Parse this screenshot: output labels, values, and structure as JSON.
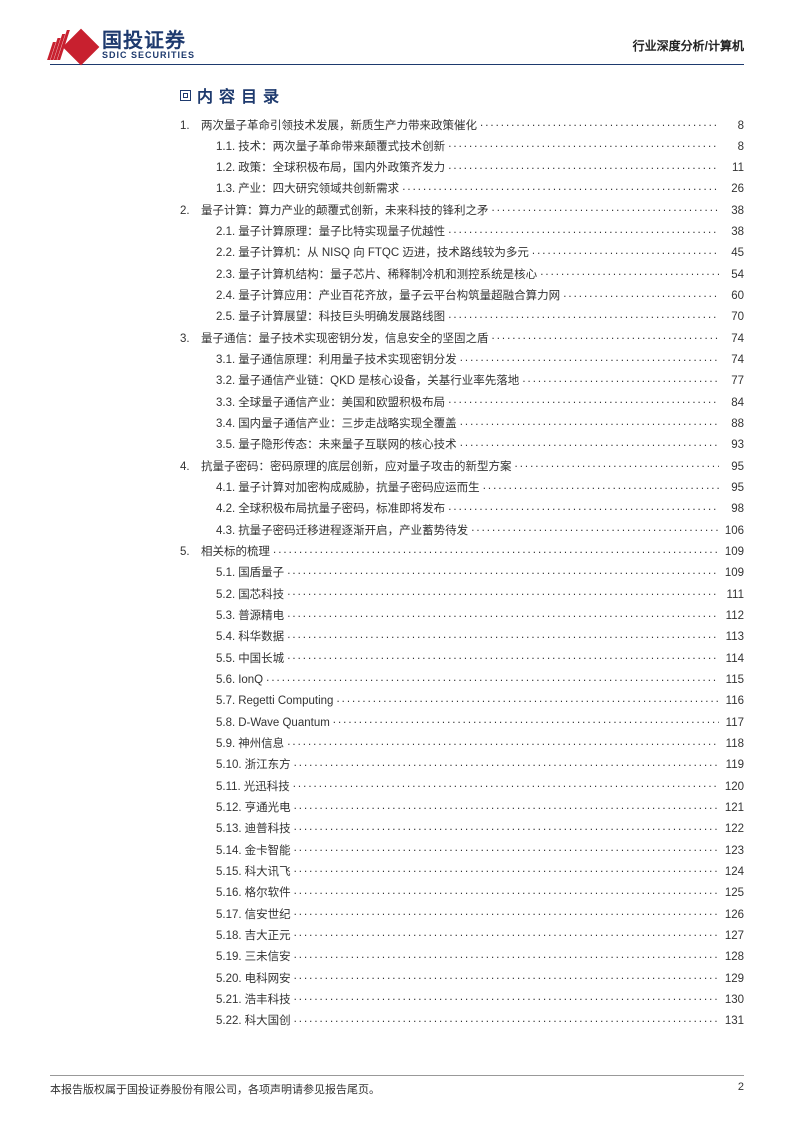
{
  "header": {
    "logo_cn": "国投证券",
    "logo_en": "SDIC SECURITIES",
    "doc_tag": "行业深度分析/计算机"
  },
  "toc_title": "内容目录",
  "toc": [
    {
      "level": 1,
      "num": "1.",
      "text": "两次量子革命引领技术发展，新质生产力带来政策催化",
      "page": "8"
    },
    {
      "level": 2,
      "num": "1.1.",
      "text": "技术：两次量子革命带来颠覆式技术创新",
      "page": "8"
    },
    {
      "level": 2,
      "num": "1.2.",
      "text": "政策：全球积极布局，国内外政策齐发力",
      "page": "11"
    },
    {
      "level": 2,
      "num": "1.3.",
      "text": "产业：四大研究领域共创新需求",
      "page": "26"
    },
    {
      "level": 1,
      "num": "2.",
      "text": "量子计算：算力产业的颠覆式创新，未来科技的锋利之矛",
      "page": "38"
    },
    {
      "level": 2,
      "num": "2.1.",
      "text": "量子计算原理：量子比特实现量子优越性",
      "page": "38"
    },
    {
      "level": 2,
      "num": "2.2.",
      "text": "量子计算机：从 NISQ 向 FTQC 迈进，技术路线较为多元",
      "page": "45"
    },
    {
      "level": 2,
      "num": "2.3.",
      "text": "量子计算机结构：量子芯片、稀释制冷机和测控系统是核心",
      "page": "54"
    },
    {
      "level": 2,
      "num": "2.4.",
      "text": "量子计算应用：产业百花齐放，量子云平台构筑量超融合算力网",
      "page": "60"
    },
    {
      "level": 2,
      "num": "2.5.",
      "text": "量子计算展望：科技巨头明确发展路线图",
      "page": "70"
    },
    {
      "level": 1,
      "num": "3.",
      "text": "量子通信：量子技术实现密钥分发，信息安全的坚固之盾",
      "page": "74"
    },
    {
      "level": 2,
      "num": "3.1.",
      "text": "量子通信原理：利用量子技术实现密钥分发",
      "page": "74"
    },
    {
      "level": 2,
      "num": "3.2.",
      "text": "量子通信产业链：QKD 是核心设备，关基行业率先落地",
      "page": "77"
    },
    {
      "level": 2,
      "num": "3.3.",
      "text": "全球量子通信产业：美国和欧盟积极布局",
      "page": "84"
    },
    {
      "level": 2,
      "num": "3.4.",
      "text": "国内量子通信产业：三步走战略实现全覆盖",
      "page": "88"
    },
    {
      "level": 2,
      "num": "3.5.",
      "text": "量子隐形传态：未来量子互联网的核心技术",
      "page": "93"
    },
    {
      "level": 1,
      "num": "4.",
      "text": "抗量子密码：密码原理的底层创新，应对量子攻击的新型方案",
      "page": "95"
    },
    {
      "level": 2,
      "num": "4.1.",
      "text": "量子计算对加密构成威胁，抗量子密码应运而生",
      "page": "95"
    },
    {
      "level": 2,
      "num": "4.2.",
      "text": "全球积极布局抗量子密码，标准即将发布",
      "page": "98"
    },
    {
      "level": 2,
      "num": "4.3.",
      "text": "抗量子密码迁移进程逐渐开启，产业蓄势待发",
      "page": "106"
    },
    {
      "level": 1,
      "num": "5.",
      "text": "相关标的梳理",
      "page": "109"
    },
    {
      "level": 2,
      "num": "5.1.",
      "text": "国盾量子",
      "page": "109"
    },
    {
      "level": 2,
      "num": "5.2.",
      "text": "国芯科技",
      "page": "111"
    },
    {
      "level": 2,
      "num": "5.3.",
      "text": "普源精电",
      "page": "112"
    },
    {
      "level": 2,
      "num": "5.4.",
      "text": "科华数据",
      "page": "113"
    },
    {
      "level": 2,
      "num": "5.5.",
      "text": "中国长城",
      "page": "114"
    },
    {
      "level": 2,
      "num": "5.6.",
      "text": "IonQ",
      "page": "115"
    },
    {
      "level": 2,
      "num": "5.7.",
      "text": "Regetti Computing",
      "page": "116"
    },
    {
      "level": 2,
      "num": "5.8.",
      "text": "D-Wave Quantum",
      "page": "117"
    },
    {
      "level": 2,
      "num": "5.9.",
      "text": "神州信息",
      "page": "118"
    },
    {
      "level": 2,
      "num": "5.10.",
      "text": "浙江东方",
      "page": "119"
    },
    {
      "level": 2,
      "num": "5.11.",
      "text": "光迅科技",
      "page": "120"
    },
    {
      "level": 2,
      "num": "5.12.",
      "text": "亨通光电",
      "page": "121"
    },
    {
      "level": 2,
      "num": "5.13.",
      "text": "迪普科技",
      "page": "122"
    },
    {
      "level": 2,
      "num": "5.14.",
      "text": "金卡智能",
      "page": "123"
    },
    {
      "level": 2,
      "num": "5.15.",
      "text": "科大讯飞",
      "page": "124"
    },
    {
      "level": 2,
      "num": "5.16.",
      "text": "格尔软件",
      "page": "125"
    },
    {
      "level": 2,
      "num": "5.17.",
      "text": "信安世纪",
      "page": "126"
    },
    {
      "level": 2,
      "num": "5.18.",
      "text": "吉大正元",
      "page": "127"
    },
    {
      "level": 2,
      "num": "5.19.",
      "text": "三未信安",
      "page": "128"
    },
    {
      "level": 2,
      "num": "5.20.",
      "text": "电科网安",
      "page": "129"
    },
    {
      "level": 2,
      "num": "5.21.",
      "text": "浩丰科技",
      "page": "130"
    },
    {
      "level": 2,
      "num": "5.22.",
      "text": "科大国创",
      "page": "131"
    }
  ],
  "footer": {
    "copyright": "本报告版权属于国投证券股份有限公司，各项声明请参见报告尾页。",
    "page_number": "2"
  }
}
